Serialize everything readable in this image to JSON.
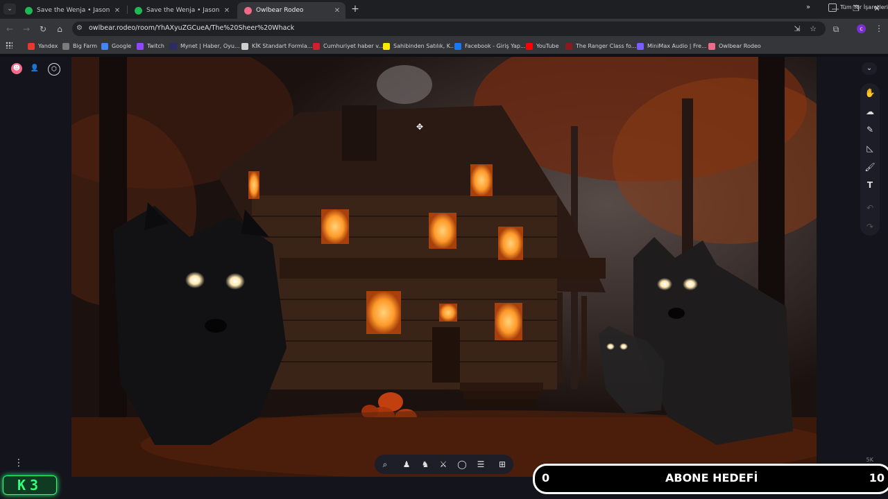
{
  "browser": {
    "tabs": [
      {
        "title": "Save the Wenja • Jason Graves",
        "close": "✕"
      },
      {
        "title": "Save the Wenja • Jason Graves",
        "close": "✕"
      },
      {
        "title": "Owlbear Rodeo",
        "close": "✕"
      }
    ],
    "new_tab": "+",
    "window_controls": {
      "minimize": "—",
      "restore": "❐",
      "close": "✕"
    },
    "url": "owlbear.rodeo/room/YhAXyuZGCueA/The%20Sheer%20Whack",
    "bookmarks": [
      {
        "label": "Yandex",
        "color": "#e63a2e"
      },
      {
        "label": "Big Farm",
        "color": "#7c7c7c"
      },
      {
        "label": "Google",
        "color": "#4285f4"
      },
      {
        "label": "Twitch",
        "color": "#9146ff"
      },
      {
        "label": "Mynet | Haber, Oyu...",
        "color": "#2b2b6a"
      },
      {
        "label": "KİK Standart Formla...",
        "color": "#cfcfcf"
      },
      {
        "label": "Cumhuriyet haber v...",
        "color": "#d21f2a"
      },
      {
        "label": "Sahibinden Satılık, K...",
        "color": "#ffe800"
      },
      {
        "label": "Facebook - Giriş Yap...",
        "color": "#1877f2"
      },
      {
        "label": "YouTube",
        "color": "#ff0000"
      },
      {
        "label": "The Ranger Class fo...",
        "color": "#8b1a1a"
      },
      {
        "label": "MiniMax Audio | Fre...",
        "color": "#7a5cff"
      },
      {
        "label": "Owlbear Rodeo",
        "color": "#f06a8a"
      }
    ],
    "all_bookmarks": "Tüm Yer İşaretleri",
    "more": "»"
  },
  "overlay": {
    "k3": "K3",
    "goal_low": "0",
    "goal_title": "ABONE HEDEFİ",
    "goal_high": "10",
    "goal_high_small": "5K"
  },
  "colors": {
    "accent_green": "#32ff7a",
    "owlbear_pink": "#f06a8a"
  }
}
